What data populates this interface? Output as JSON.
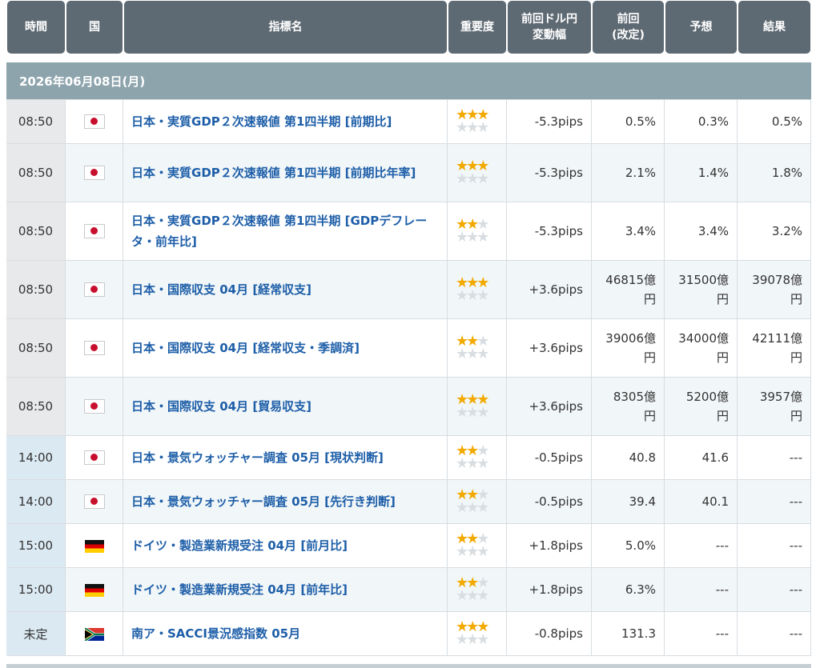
{
  "headers": {
    "time": "時間",
    "country": "国",
    "indicator": "指標名",
    "importance": "重要度",
    "pips_change": "前回ドル円\n変動幅",
    "previous": "前回\n(改定)",
    "forecast": "予想",
    "result": "結果"
  },
  "date_label": "2026年06月08日(月)",
  "colors": {
    "header_bg": "#5e6a73",
    "date_bar": "#8ea4ad",
    "link": "#1d5ea8",
    "star": "#f2a900"
  },
  "events": [
    {
      "time": "08:50",
      "country": "jp-flag-icon",
      "name": "日本・実質GDP２次速報値 第1四半期 [前期比]",
      "stars": 3,
      "pips": "-5.3pips",
      "previous_1": "0.5%",
      "previous_2": "",
      "forecast_1": "0.3%",
      "forecast_2": "",
      "result_1": "0.5%",
      "result_2": ""
    },
    {
      "time": "08:50",
      "country": "jp-flag-icon",
      "name": "日本・実質GDP２次速報値 第1四半期 [前期比年率]",
      "stars": 3,
      "pips": "-5.3pips",
      "previous_1": "2.1%",
      "previous_2": "",
      "forecast_1": "1.4%",
      "forecast_2": "",
      "result_1": "1.8%",
      "result_2": ""
    },
    {
      "time": "08:50",
      "country": "jp-flag-icon",
      "name": "日本・実質GDP２次速報値 第1四半期 [GDPデフレータ・前年比]",
      "stars": 2,
      "pips": "-5.3pips",
      "previous_1": "3.4%",
      "previous_2": "",
      "forecast_1": "3.4%",
      "forecast_2": "",
      "result_1": "3.2%",
      "result_2": ""
    },
    {
      "time": "08:50",
      "country": "jp-flag-icon",
      "name": "日本・国際収支 04月 [経常収支]",
      "stars": 3,
      "pips": "+3.6pips",
      "previous_1": "46815億",
      "previous_2": "円",
      "forecast_1": "31500億",
      "forecast_2": "円",
      "result_1": "39078億",
      "result_2": "円"
    },
    {
      "time": "08:50",
      "country": "jp-flag-icon",
      "name": "日本・国際収支 04月 [経常収支・季調済]",
      "stars": 2,
      "pips": "+3.6pips",
      "previous_1": "39006億",
      "previous_2": "円",
      "forecast_1": "34000億",
      "forecast_2": "円",
      "result_1": "42111億",
      "result_2": "円"
    },
    {
      "time": "08:50",
      "country": "jp-flag-icon",
      "name": "日本・国際収支 04月 [貿易収支]",
      "stars": 3,
      "pips": "+3.6pips",
      "previous_1": "8305億",
      "previous_2": "円",
      "forecast_1": "5200億",
      "forecast_2": "円",
      "result_1": "3957億",
      "result_2": "円"
    },
    {
      "time": "14:00",
      "country": "jp-flag-icon",
      "name": "日本・景気ウォッチャー調査 05月 [現状判断]",
      "stars": 2,
      "pips": "-0.5pips",
      "previous_1": "40.8",
      "previous_2": "",
      "forecast_1": "41.6",
      "forecast_2": "",
      "result_1": "---",
      "result_2": ""
    },
    {
      "time": "14:00",
      "country": "jp-flag-icon",
      "name": "日本・景気ウォッチャー調査 05月 [先行き判断]",
      "stars": 2,
      "pips": "-0.5pips",
      "previous_1": "39.4",
      "previous_2": "",
      "forecast_1": "40.1",
      "forecast_2": "",
      "result_1": "---",
      "result_2": ""
    },
    {
      "time": "15:00",
      "country": "de-flag-icon",
      "name": "ドイツ・製造業新規受注 04月 [前月比]",
      "stars": 2,
      "pips": "+1.8pips",
      "previous_1": "5.0%",
      "previous_2": "",
      "forecast_1": "---",
      "forecast_2": "",
      "result_1": "---",
      "result_2": ""
    },
    {
      "time": "15:00",
      "country": "de-flag-icon",
      "name": "ドイツ・製造業新規受注 04月 [前年比]",
      "stars": 2,
      "pips": "+1.8pips",
      "previous_1": "6.3%",
      "previous_2": "",
      "forecast_1": "---",
      "forecast_2": "",
      "result_1": "---",
      "result_2": ""
    },
    {
      "time": "未定",
      "country": "za-flag-icon",
      "name": "南ア・SACCI景況感指数 05月",
      "stars": 3,
      "pips": "-0.8pips",
      "previous_1": "131.3",
      "previous_2": "",
      "forecast_1": "---",
      "forecast_2": "",
      "result_1": "---",
      "result_2": ""
    }
  ]
}
